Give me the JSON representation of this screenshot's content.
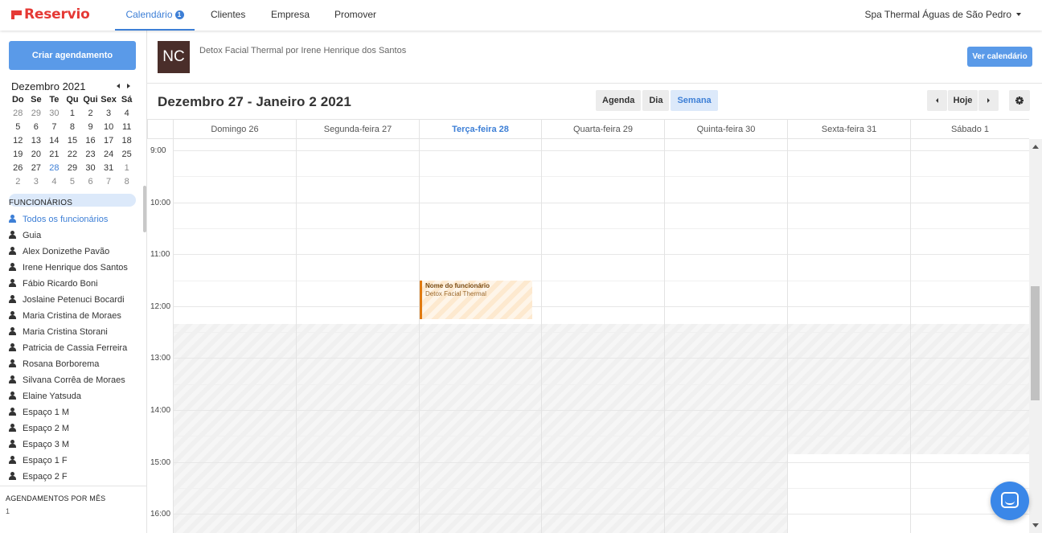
{
  "app": {
    "logo_text": "Reservio",
    "brand_color": "#e53935",
    "accent_color": "#3d7fd6"
  },
  "topnav": {
    "items": [
      {
        "label": "Calendário",
        "badge": "1",
        "active": true
      },
      {
        "label": "Clientes"
      },
      {
        "label": "Empresa"
      },
      {
        "label": "Promover"
      }
    ],
    "company": "Spa Thermal Águas de São Pedro"
  },
  "sidebar": {
    "create_button": "Criar agendamento",
    "mini_calendar": {
      "title": "Dezembro 2021",
      "weekdays": [
        "Do",
        "Se",
        "Te",
        "Qu",
        "Qui",
        "Sex",
        "Sá"
      ],
      "weeks": [
        [
          "28",
          "29",
          "30",
          "1",
          "2",
          "3",
          "4"
        ],
        [
          "5",
          "6",
          "7",
          "8",
          "9",
          "10",
          "11"
        ],
        [
          "12",
          "13",
          "14",
          "15",
          "16",
          "17",
          "18"
        ],
        [
          "19",
          "20",
          "21",
          "22",
          "23",
          "24",
          "25"
        ],
        [
          "26",
          "27",
          "28",
          "29",
          "30",
          "31",
          "1"
        ],
        [
          "2",
          "3",
          "4",
          "5",
          "6",
          "7",
          "8"
        ]
      ],
      "selected_week_index": 4,
      "selected_day": "28"
    },
    "staff_title": "FUNCIONÁRIOS",
    "staff": [
      {
        "name": "Todos os funcionários",
        "active": true
      },
      {
        "name": "Guia"
      },
      {
        "name": "Alex Donizethe Pavão"
      },
      {
        "name": "Irene Henrique dos Santos"
      },
      {
        "name": "Fábio Ricardo Boni"
      },
      {
        "name": "Joslaine Petenuci Bocardi"
      },
      {
        "name": "Maria Cristina de Moraes"
      },
      {
        "name": "Maria Cristina Storani"
      },
      {
        "name": "Patricia de Cassia Ferreira"
      },
      {
        "name": "Rosana Borborema"
      },
      {
        "name": "Silvana Corrêa de Moraes"
      },
      {
        "name": "Elaine Yatsuda"
      },
      {
        "name": "Espaço 1 M"
      },
      {
        "name": "Espaço 2 M"
      },
      {
        "name": "Espaço 3 M"
      },
      {
        "name": "Espaço 1 F"
      },
      {
        "name": "Espaço 2 F"
      }
    ],
    "monthly_title": "AGENDAMENTOS POR MÊS",
    "monthly_value": "1"
  },
  "resource": {
    "avatar_initials": "NC",
    "name": "Detox Facial Thermal por Irene Henrique dos Santos",
    "calendar_button": "Ver calendário"
  },
  "toolbar": {
    "range_title": "Dezembro 27 - Janeiro 2 2021",
    "views": [
      {
        "label": "Agenda"
      },
      {
        "label": "Dia"
      },
      {
        "label": "Semana",
        "active": true
      }
    ],
    "today_button": "Hoje"
  },
  "calendar": {
    "days": [
      {
        "label": "Domingo 26"
      },
      {
        "label": "Segunda-feira 27"
      },
      {
        "label": "Terça-feira 28",
        "today": true
      },
      {
        "label": "Quarta-feira 29"
      },
      {
        "label": "Quinta-feira 30"
      },
      {
        "label": "Sexta-feira 31"
      },
      {
        "label": "Sábado 1"
      }
    ],
    "hours": [
      "9:00",
      "10:00",
      "11:00",
      "12:00",
      "13:00",
      "14:00",
      "15:00",
      "16:00"
    ],
    "event": {
      "title": "Nome do funcionário",
      "subtitle": "Detox Facial Thermal",
      "day": "Terça-feira 28",
      "start": "11:30",
      "end": "12:15",
      "color": "#e07a10"
    }
  }
}
